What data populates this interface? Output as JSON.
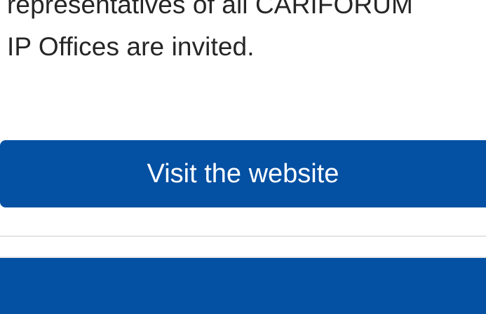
{
  "content": {
    "paragraph_lines": [
      "representatives of all CARIFORUM",
      "IP Offices are invited."
    ]
  },
  "cta": {
    "label": "Visit the website"
  },
  "colors": {
    "brand_blue": "#0450a3",
    "text": "#262626",
    "divider": "#e3e3e3"
  }
}
